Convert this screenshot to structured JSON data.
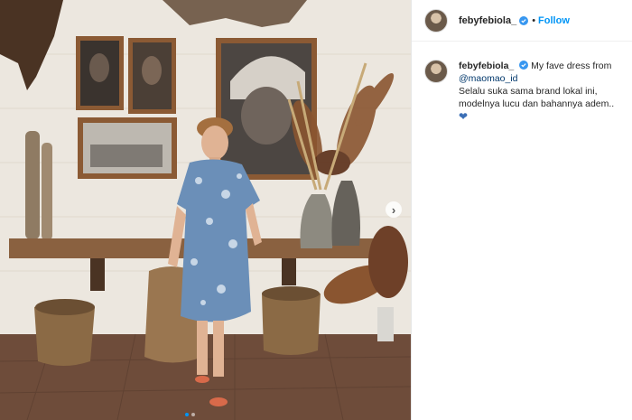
{
  "post": {
    "username": "febyfebiola_",
    "follow_label": "Follow",
    "caption_username": "febyfebiola_",
    "caption_line1": "My fave dress from",
    "mention": "@maomao_id",
    "caption_line2": "Selalu suka sama brand lokal ini, modelnya lucu dan bahannya adem..",
    "verified_color": "#3897f0",
    "accent_color": "#0095f6"
  },
  "carousel": {
    "total_slides": 2,
    "current_slide": 1
  },
  "icons": {
    "verified": "verified-badge-icon",
    "heart": "blue-heart-emoji",
    "next": "chevron-right-icon"
  }
}
